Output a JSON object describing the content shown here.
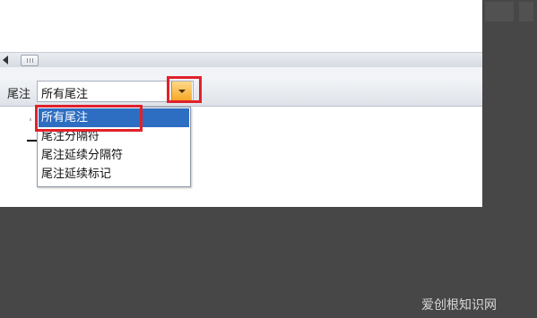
{
  "footnote_pane": {
    "label": "尾注",
    "combo_value": "所有尾注",
    "dropdown_options": [
      "所有尾注",
      "尾注分隔符",
      "尾注延续分隔符",
      "尾注延续标记"
    ],
    "selected_index": 0
  },
  "watermark": "爱创根知识网",
  "colors": {
    "highlight": "#e0212a",
    "selection": "#2e6ec2",
    "combo_button": "#f6a827",
    "outer_background": "#474747"
  }
}
